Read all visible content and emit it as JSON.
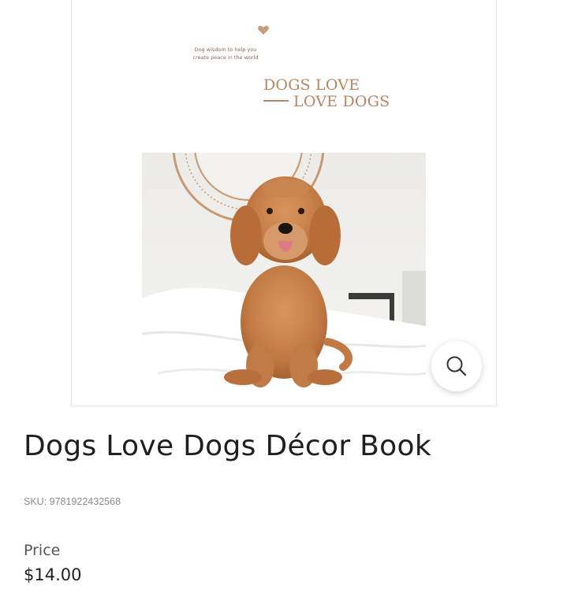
{
  "product": {
    "cover": {
      "tagline": "Dog wisdom to help you\ncreate peace in the world",
      "title_line1": "DOGS LOVE",
      "title_line2": "LOVE DOGS",
      "accent_color": "#b48663"
    },
    "zoom_icon": "search-icon",
    "title": "Dogs Love Dogs Décor Book",
    "sku": "SKU: 9781922432568",
    "price_label": "Price",
    "price": "$14.00"
  }
}
